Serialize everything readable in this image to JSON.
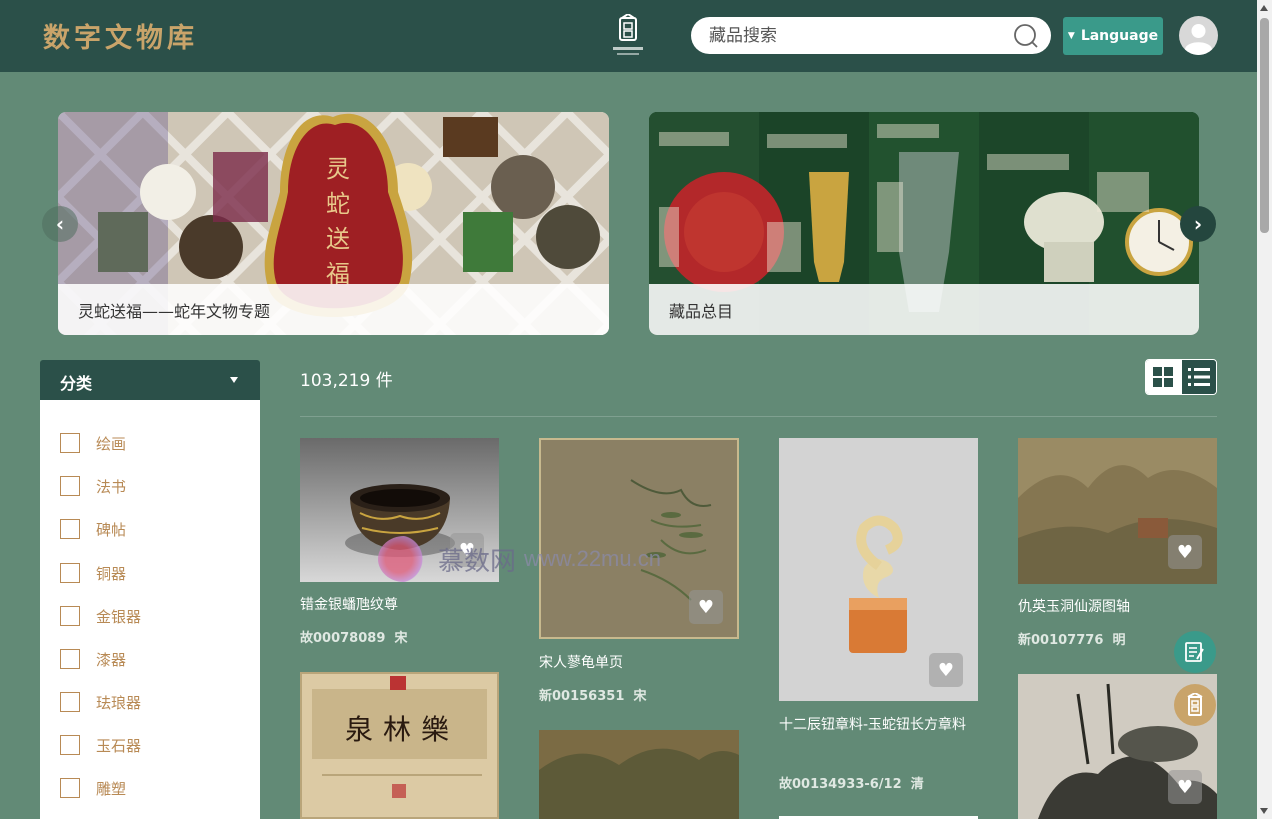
{
  "header": {
    "site_title": "数字文物库",
    "search_placeholder": "藏品搜索",
    "language_label": "Language"
  },
  "banners": [
    {
      "caption": "灵蛇送福——蛇年文物专题",
      "art_text": "灵蛇送福"
    },
    {
      "caption": "藏品总目"
    }
  ],
  "sidebar": {
    "heading": "分类",
    "categories": [
      "绘画",
      "法书",
      "碑帖",
      "铜器",
      "金银器",
      "漆器",
      "珐琅器",
      "玉石器",
      "雕塑"
    ]
  },
  "results": {
    "count": "103,219 件"
  },
  "cards": [
    {
      "title": "错金银蟠虺纹尊",
      "number": "故00078089",
      "dynasty": "宋"
    },
    {
      "title": "宋人蓼龟单页",
      "number": "新00156351",
      "dynasty": "宋"
    },
    {
      "title": "十二辰钮章料-玉蛇钮长方章料",
      "number": "故00134933-6/12",
      "dynasty": "清"
    },
    {
      "title": "仇英玉洞仙源图轴",
      "number": "新00107776",
      "dynasty": "明"
    },
    {
      "art_text": "泉林樂"
    }
  ],
  "watermark": {
    "name": "慕数网",
    "url": "www.22mu.cn"
  },
  "colors": {
    "header_bg": "#2b5049",
    "page_bg": "#628a76",
    "accent_gold": "#c9a46a",
    "accent_teal": "#3a9a8a",
    "category_text": "#b88a55"
  }
}
